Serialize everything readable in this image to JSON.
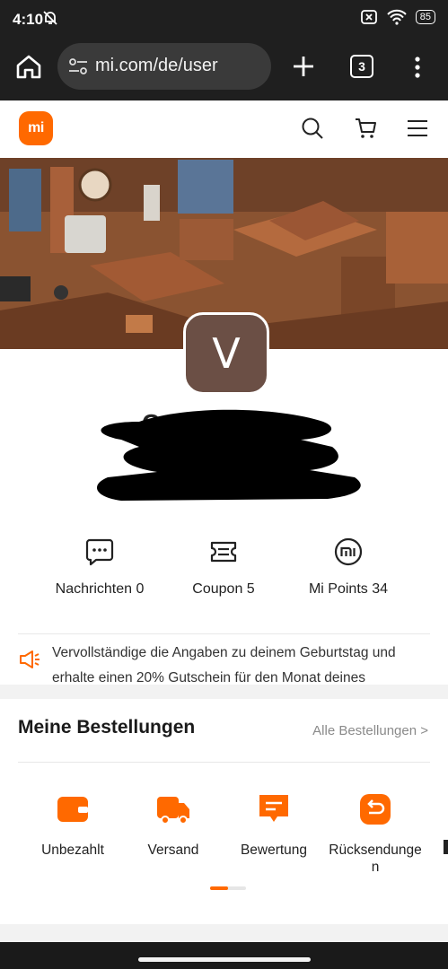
{
  "status_bar": {
    "time": "4:10",
    "battery": "85"
  },
  "browser": {
    "url": "mi.com/de/user",
    "tab_count": "3"
  },
  "site": {
    "logo_text": "mi",
    "brand_color": "#ff6900"
  },
  "profile": {
    "avatar_letter": "V",
    "name_fragment": "C"
  },
  "stats": [
    {
      "label": "Nachrichten 0",
      "icon": "chat-bubble-icon"
    },
    {
      "label": "Coupon 5",
      "icon": "coupon-icon"
    },
    {
      "label": "Mi Points 34",
      "icon": "mi-points-icon"
    }
  ],
  "notice": {
    "line1": "Vervollständige die Angaben zu deinem Geburtstag und",
    "line2": "erhalte einen 20% Gutschein für den Monat deines"
  },
  "orders": {
    "title": "Meine Bestellungen",
    "all_link": "Alle Bestellungen >",
    "items": [
      {
        "label": "Unbezahlt",
        "icon": "wallet-icon"
      },
      {
        "label": "Versand",
        "icon": "truck-icon"
      },
      {
        "label": "Bewertung",
        "icon": "review-icon"
      },
      {
        "label": "Rücksendungen",
        "icon": "return-icon"
      }
    ],
    "scroll_position": 0.5
  }
}
